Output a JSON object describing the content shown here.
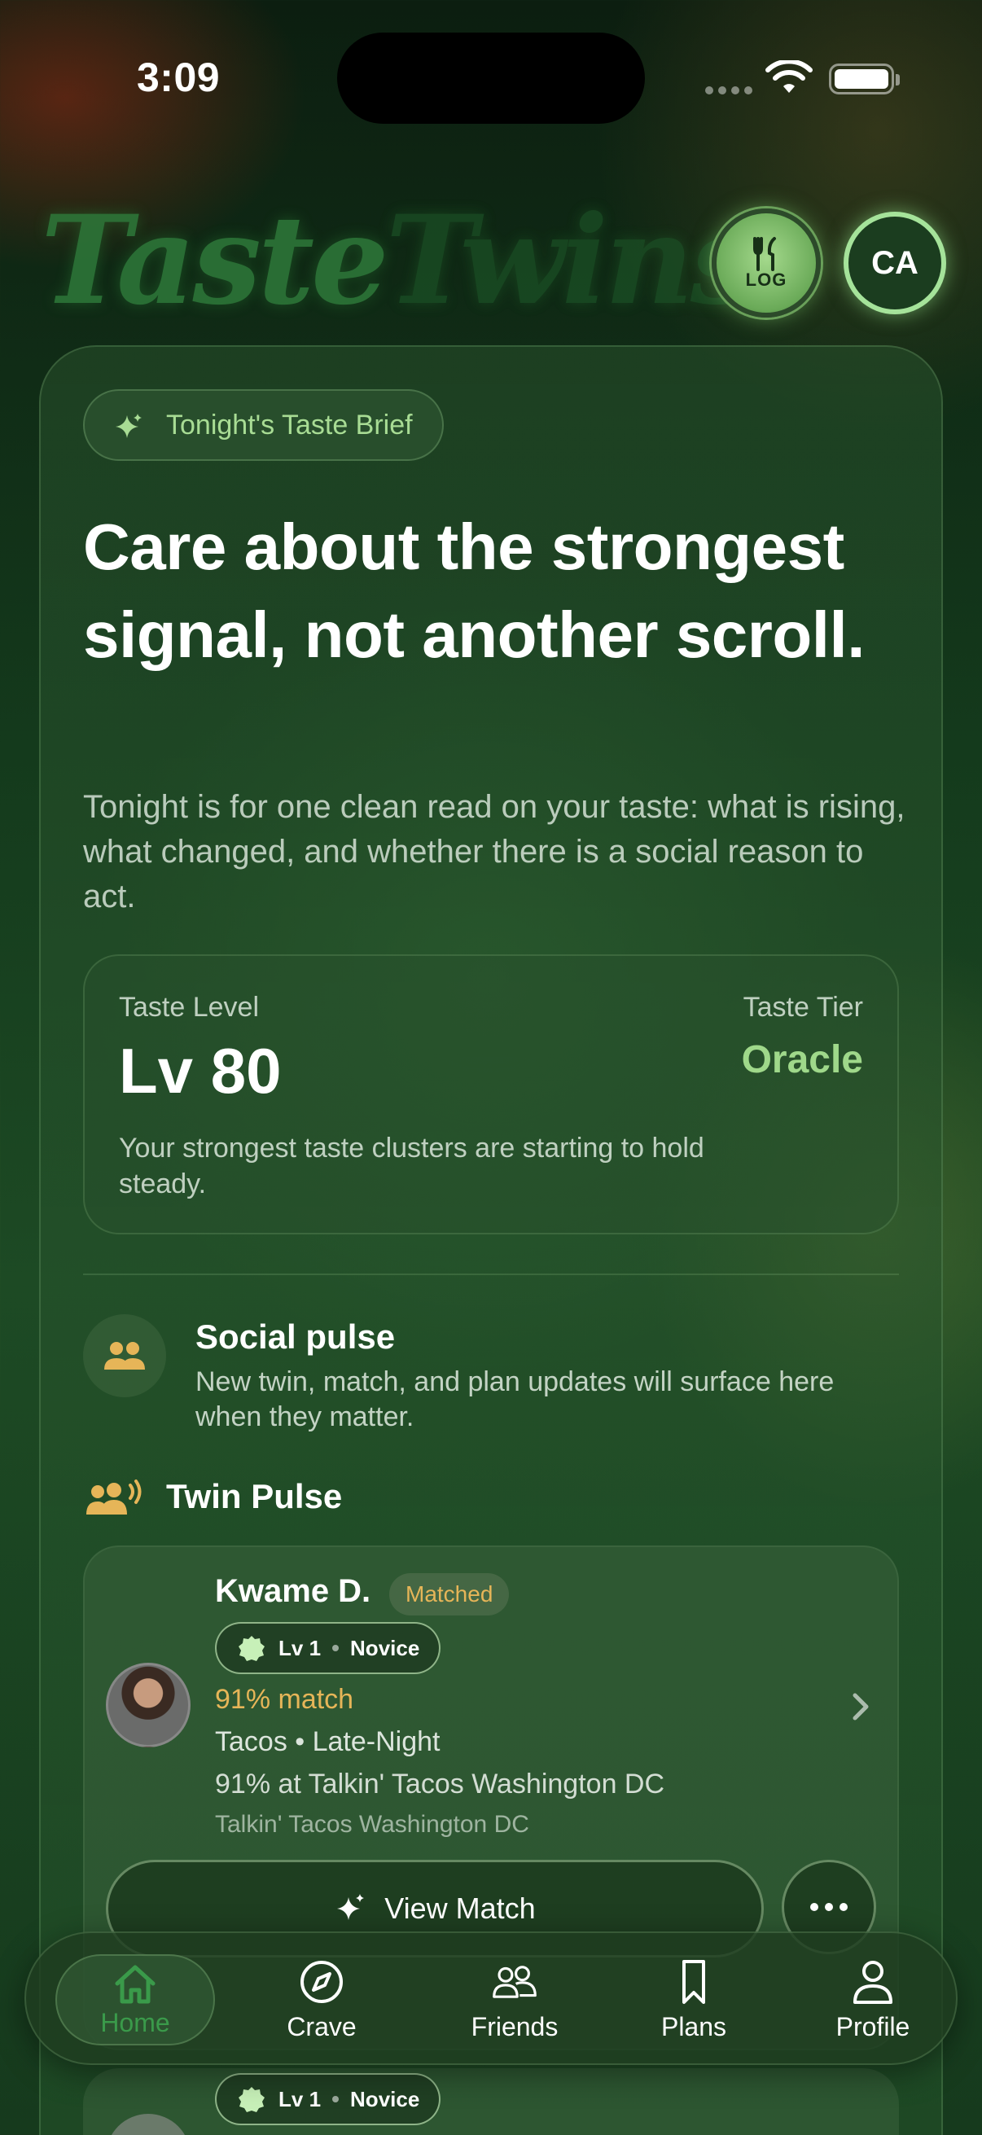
{
  "status": {
    "time": "3:09"
  },
  "header": {
    "logo_part1": "Taste",
    "logo_part2": "Twins",
    "log_label": "LOG",
    "avatar_initials": "CA"
  },
  "brief": {
    "pill_label": "Tonight's Taste Brief",
    "headline": "Care about the strongest signal, not another scroll.",
    "subtext": "Tonight is for one clean read on your taste: what is rising, what changed, and whether there is a social reason to act."
  },
  "level": {
    "label": "Taste Level",
    "value": "Lv 80",
    "tier_label": "Taste Tier",
    "tier_value": "Oracle",
    "note": "Your strongest taste clusters are starting to hold steady."
  },
  "social": {
    "title": "Social pulse",
    "desc": "New twin, match, and plan updates will surface here when they matter."
  },
  "twin_pulse": {
    "title": "Twin Pulse",
    "card": {
      "name": "Kwame D.",
      "badge": "Matched",
      "level": "Lv 1",
      "tier": "Novice",
      "match": "91% match",
      "cuisine": "Tacos • Late-Night",
      "detail": "91% at Talkin' Tacos Washington DC",
      "venue": "Talkin' Tacos Washington DC",
      "view_button": "View Match"
    },
    "card2": {
      "level": "Lv 1",
      "tier": "Novice"
    }
  },
  "tabs": [
    {
      "label": "Home"
    },
    {
      "label": "Crave"
    },
    {
      "label": "Friends"
    },
    {
      "label": "Plans"
    },
    {
      "label": "Profile"
    }
  ],
  "colors": {
    "accent_green": "#9fd88a",
    "accent_gold": "#e6b558",
    "active_tab": "#3a9a4a"
  }
}
